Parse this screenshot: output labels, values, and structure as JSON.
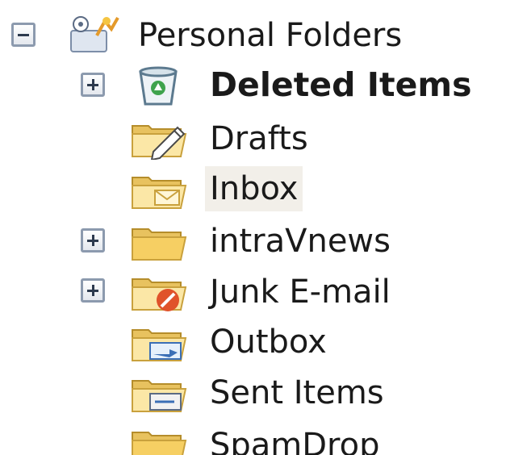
{
  "tree": {
    "root": {
      "label": "Personal Folders",
      "icon": "personal-folders-icon",
      "expanded": true
    },
    "items": [
      {
        "label": "Deleted Items",
        "icon": "recycle-bin-icon",
        "expandable": true,
        "bold": true
      },
      {
        "label": "Drafts",
        "icon": "drafts-folder-icon",
        "expandable": false
      },
      {
        "label": "Inbox",
        "icon": "inbox-folder-icon",
        "expandable": false,
        "selected": true
      },
      {
        "label": "intraVnews",
        "icon": "folder-icon",
        "expandable": true
      },
      {
        "label": "Junk E-mail",
        "icon": "junk-mail-folder-icon",
        "expandable": true
      },
      {
        "label": "Outbox",
        "icon": "outbox-folder-icon",
        "expandable": false
      },
      {
        "label": "Sent Items",
        "icon": "sent-items-folder-icon",
        "expandable": false
      },
      {
        "label": "SpamDrop",
        "icon": "folder-icon",
        "expandable": false
      }
    ]
  },
  "colors": {
    "folder_light": "#fbe7a6",
    "folder_dark": "#e0b44a",
    "selected_bg": "#f2efe9",
    "expander_border": "#8c9aae"
  }
}
